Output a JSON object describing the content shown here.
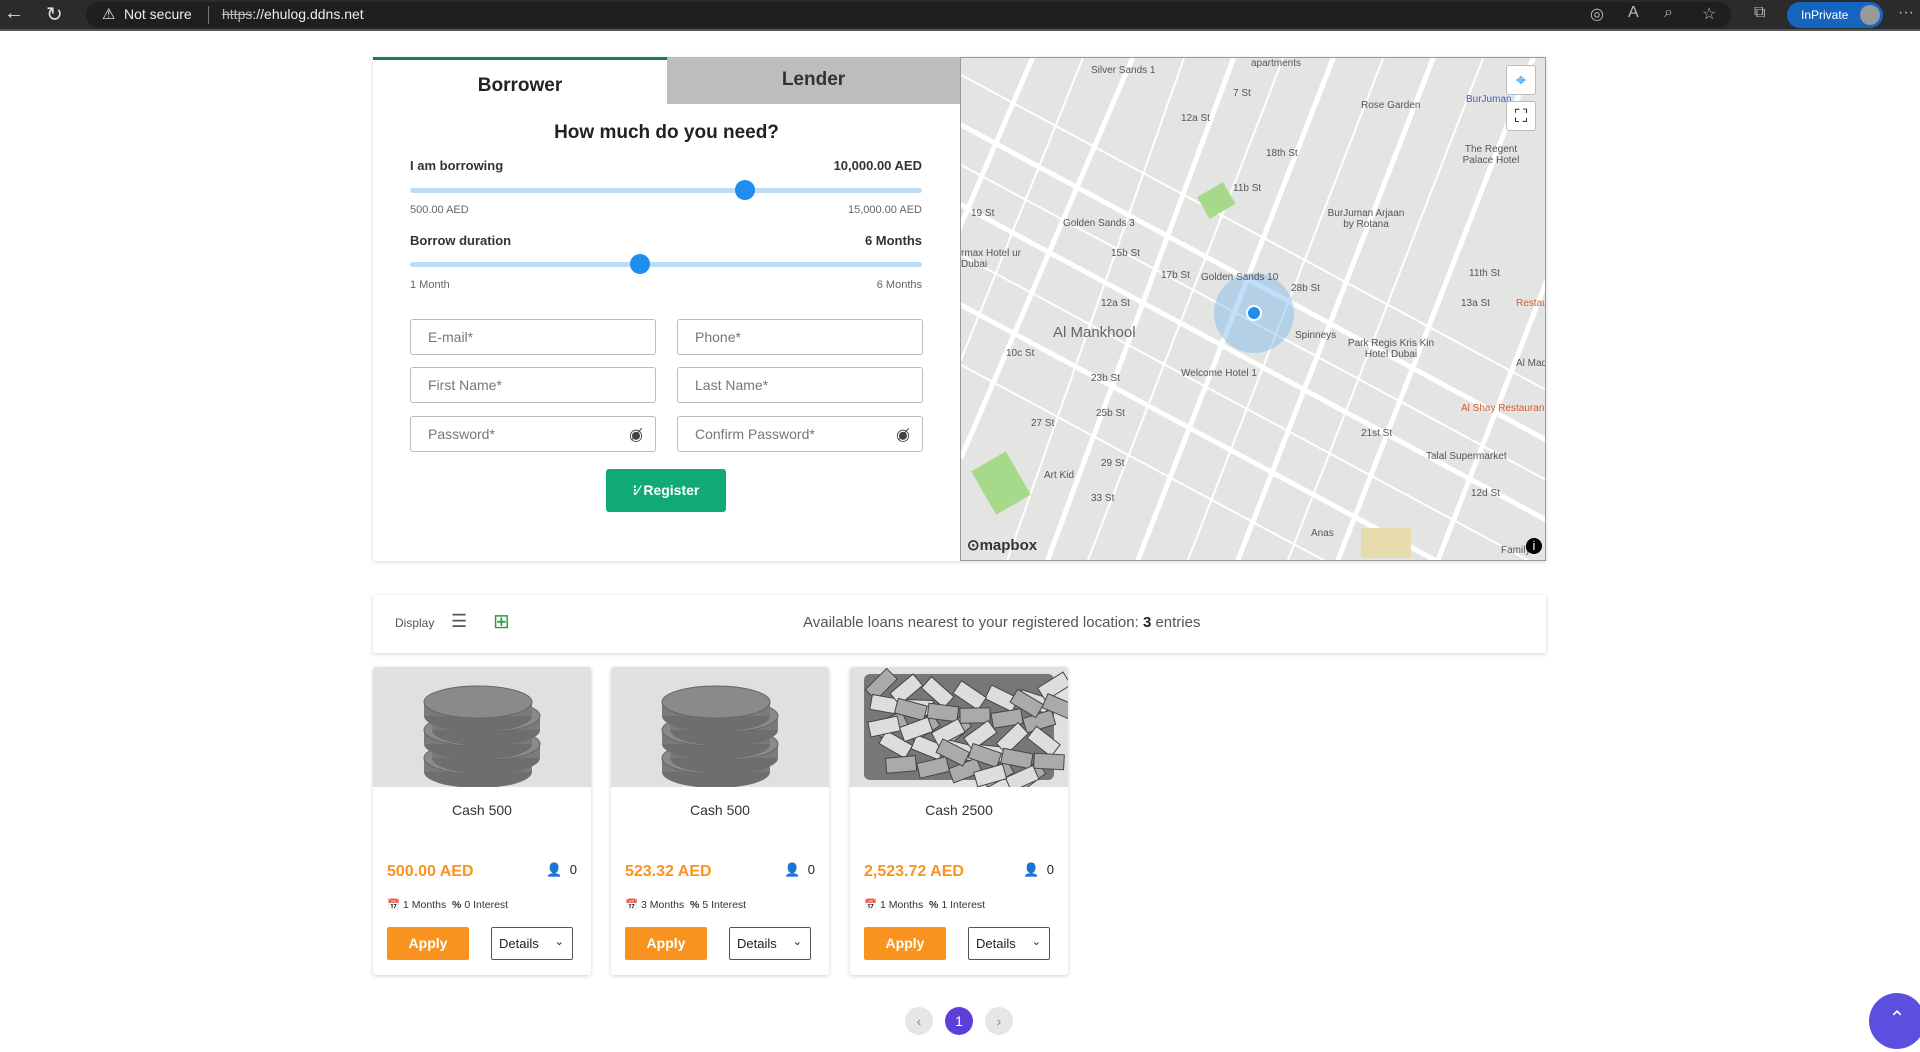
{
  "browser": {
    "security": "Not secure",
    "url_scheme": "https",
    "url_rest": "://ehulog.ddns.net",
    "inprivate": "InPrivate"
  },
  "tabs": [
    {
      "label": "Borrower",
      "active": true
    },
    {
      "label": "Lender",
      "active": false
    }
  ],
  "form": {
    "heading": "How much do you need?",
    "amount": {
      "label": "I am borrowing",
      "value": "10,000.00 AED",
      "min": "500.00 AED",
      "max": "15,000.00 AED",
      "position": 0.655
    },
    "duration": {
      "label": "Borrow duration",
      "value": "6 Months",
      "min": "1 Month",
      "max": "6 Months",
      "position": 0.45
    },
    "fields": {
      "email": "E-mail*",
      "phone": "Phone*",
      "first_name": "First Name*",
      "last_name": "Last Name*",
      "password": "Password*",
      "confirm_password": "Confirm Password*"
    },
    "register": "Register"
  },
  "map": {
    "attribution": "mapbox",
    "labels": [
      "Silver Sands 1",
      "apartments",
      "Rose Garden",
      "BurJuman",
      "The Regent Palace Hotel",
      "BurJuman Arjaan by Rotana",
      "Golden Sands 3",
      "Golden Sands 10",
      "Al Mankhool",
      "Spinneys",
      "Park Regis Kris Kin Hotel Dubai",
      "Welcome Hotel 1",
      "Al Shay Restaurant",
      "Talal Supermarket",
      "Art Kid",
      "Anas",
      "Family S",
      "Restauran",
      "Al Mad",
      "rmax Hotel ur Dubai",
      "7 St",
      "12a St",
      "18th St",
      "11b St",
      "11th St",
      "13a St",
      "17b St",
      "12a St",
      "10c St",
      "23b St",
      "25b St",
      "27 St",
      "29 St",
      "33 St",
      "21st St",
      "12d St",
      "28b St",
      "15b St",
      "19 St"
    ]
  },
  "display": {
    "label": "Display",
    "summary_prefix": "Available loans nearest to your registered location: ",
    "count": "3",
    "summary_suffix": " entries"
  },
  "loans": [
    {
      "title": "Cash 500",
      "price": "500.00 AED",
      "users": "0",
      "duration": "1 Months",
      "interest": "0 Interest",
      "image": "coins",
      "apply": "Apply",
      "details": "Details"
    },
    {
      "title": "Cash 500",
      "price": "523.32 AED",
      "users": "0",
      "duration": "3 Months",
      "interest": "5 Interest",
      "image": "coins",
      "apply": "Apply",
      "details": "Details"
    },
    {
      "title": "Cash 2500",
      "price": "2,523.72 AED",
      "users": "0",
      "duration": "1 Months",
      "interest": "1 Interest",
      "image": "banknotes",
      "apply": "Apply",
      "details": "Details"
    }
  ],
  "pagination": {
    "current": "1"
  },
  "colors": {
    "accent_green": "#10aa78",
    "tab_green": "#1c7a52",
    "price_orange": "#f7931e",
    "slider_blue": "#1e8fef",
    "page_purple": "#5b3fd8"
  }
}
